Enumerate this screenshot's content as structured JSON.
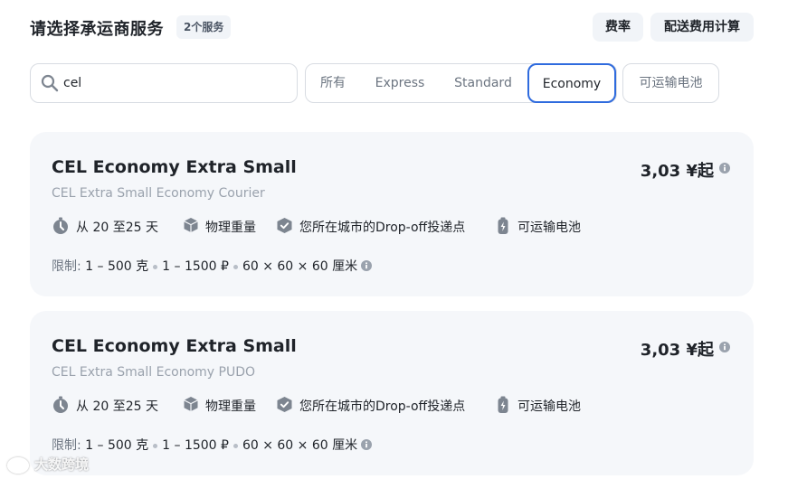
{
  "header": {
    "title": "请选择承运商服务",
    "service_count": "2个服务",
    "rates_button": "费率",
    "calc_button": "配送费用计算"
  },
  "search": {
    "value": "cel",
    "icon": "search-icon"
  },
  "filters": {
    "tabs": [
      {
        "label": "所有",
        "selected": false
      },
      {
        "label": "Express",
        "selected": false
      },
      {
        "label": "Standard",
        "selected": false
      },
      {
        "label": "Economy",
        "selected": true
      }
    ],
    "battery_toggle": "可运输电池"
  },
  "colors": {
    "accent": "#2f6bde",
    "card_bg": "#f5f7fa",
    "muted_text": "#9aa2ad"
  },
  "cards": [
    {
      "title": "CEL Economy Extra Small",
      "subtitle": "CEL Extra Small Economy Courier",
      "price": "3,03 ¥起",
      "features": {
        "delivery_time": "从 20 至25 天",
        "weight": "物理重量",
        "dropoff": "您所在城市的Drop-off投递点",
        "battery": "可运输电池"
      },
      "limits": {
        "label": "限制:",
        "weight": "1 – 500 克",
        "value": "1 – 1500 ₽",
        "size": "60 × 60 × 60 厘米"
      }
    },
    {
      "title": "CEL Economy Extra Small",
      "subtitle": "CEL Extra Small Economy PUDO",
      "price": "3,03 ¥起",
      "features": {
        "delivery_time": "从 20 至25 天",
        "weight": "物理重量",
        "dropoff": "您所在城市的Drop-off投递点",
        "battery": "可运输电池"
      },
      "limits": {
        "label": "限制:",
        "weight": "1 – 500 克",
        "value": "1 – 1500 ₽",
        "size": "60 × 60 × 60 厘米"
      }
    }
  ],
  "watermark": {
    "text": "大数跨境"
  }
}
